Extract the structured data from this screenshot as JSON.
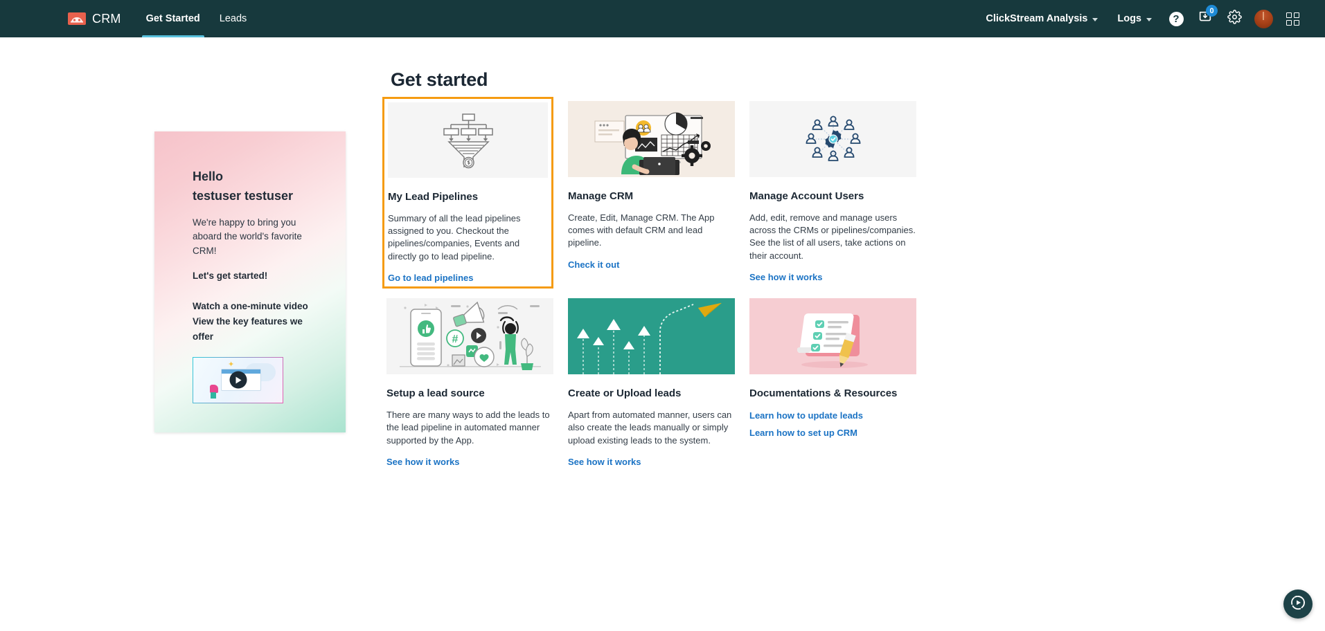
{
  "topbar": {
    "brand": "CRM",
    "brand_logo_icon": "crm-logo-icon",
    "tabs": [
      {
        "label": "Get Started",
        "active": true
      },
      {
        "label": "Leads",
        "active": false
      }
    ],
    "menus": [
      {
        "label": "ClickStream Analysis",
        "caret_icon": "chevron-down-icon"
      },
      {
        "label": "Logs",
        "caret_icon": "chevron-down-icon"
      }
    ],
    "help_icon": "help-question-icon",
    "help_label": "?",
    "inbox_icon": "inbox-download-icon",
    "inbox_badge": "0",
    "settings_icon": "gear-icon",
    "avatar_icon": "user-avatar",
    "apps_icon": "app-grid-icon",
    "accent_color": "#59c1dd",
    "background_color": "#17393d",
    "badge_color": "#1e8bd6"
  },
  "page": {
    "title": "Get started"
  },
  "welcome": {
    "hello": "Hello",
    "user_name": "testuser testuser",
    "body": "We're happy to bring you aboard the world's favorite CRM!",
    "cta": "Let's get started!",
    "links": [
      "Watch a one-minute video",
      "View the key features we offer"
    ],
    "video_thumb_icon": "play-button-icon"
  },
  "cards": [
    {
      "id": "my-lead-pipelines",
      "title": "My Lead Pipelines",
      "desc": "Summary of all the lead pipelines assigned to you. Checkout the pipelines/companies, Events and directly go to lead pipeline.",
      "links": [
        "Go to lead pipelines"
      ],
      "highlighted": true,
      "highlight_color": "#f59b10",
      "media_icon": "sales-funnel-icon",
      "media_class": "media-funnel"
    },
    {
      "id": "manage-crm",
      "title": "Manage CRM",
      "desc": "Create, Edit, Manage CRM. The App comes with default CRM and lead pipeline.",
      "links": [
        "Check it out"
      ],
      "highlighted": false,
      "media_icon": "person-at-desk-analytics-illustration",
      "media_class": "media-crm"
    },
    {
      "id": "manage-account-users",
      "title": "Manage Account Users",
      "desc": "Add, edit, remove and manage users across the CRMs or pipelines/companies. See the list of all users, take actions on their account.",
      "links": [
        "See how it works"
      ],
      "highlighted": false,
      "media_icon": "users-network-gear-icon",
      "media_class": "media-users"
    },
    {
      "id": "setup-a-lead-source",
      "title": "Setup a lead source",
      "desc": "There are many ways to add the leads to the lead pipeline in automated manner supported by the App.",
      "links": [
        "See how it works"
      ],
      "highlighted": false,
      "media_icon": "social-media-marketing-illustration",
      "media_class": "media-source"
    },
    {
      "id": "create-or-upload-leads",
      "title": "Create or Upload leads",
      "desc": "Apart from automated manner, users can also create the leads manually or simply upload existing leads to the system.",
      "links": [
        "See how it works"
      ],
      "highlighted": false,
      "media_icon": "paper-plane-arrows-illustration",
      "media_class": "media-upload"
    },
    {
      "id": "documentations-resources",
      "title": "Documentations & Resources",
      "desc": "",
      "links": [
        "Learn how to update leads",
        "Learn how to set up CRM"
      ],
      "highlighted": false,
      "media_icon": "checklist-pencil-illustration",
      "media_class": "media-docs"
    }
  ],
  "fab": {
    "icon": "play-circle-icon"
  }
}
